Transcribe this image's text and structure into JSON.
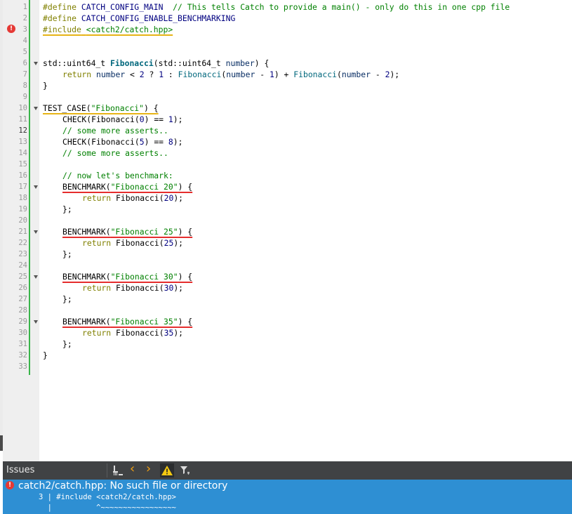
{
  "editor": {
    "line_numbers": [
      "1",
      "2",
      "3",
      "4",
      "5",
      "6",
      "7",
      "8",
      "9",
      "10",
      "11",
      "12",
      "13",
      "14",
      "15",
      "16",
      "17",
      "18",
      "19",
      "20",
      "21",
      "22",
      "23",
      "24",
      "25",
      "26",
      "27",
      "28",
      "29",
      "30",
      "31",
      "32",
      "33"
    ],
    "current_line": "12",
    "error_line": "3",
    "fold_lines": [
      "6",
      "10",
      "17",
      "21",
      "25",
      "29"
    ],
    "line1": {
      "directive": "#define",
      "macro": " CATCH_CONFIG_MAIN",
      "comment": "  // This tells Catch to provide a main() - only do this in one cpp file"
    },
    "line2": {
      "directive": "#define",
      "macro": " CATCH_CONFIG_ENABLE_BENCHMARKING"
    },
    "line3": {
      "directive": "#include",
      "path": "<catch2/catch.hpp>"
    },
    "line6": {
      "type_a": "std::uint64_t ",
      "fn": "Fibonacci",
      "open": "(",
      "type_b": "std::uint64_t ",
      "param": "number",
      "close": ") {"
    },
    "line7": {
      "kw": "return",
      "a": " ",
      "param1": "number",
      "b": " < ",
      "n2": "2",
      "c": " ? ",
      "n1": "1",
      "d": " : ",
      "fn1": "Fibonacci",
      "e": "(",
      "param2": "number",
      "f": " - ",
      "n3": "1",
      "g": ") + ",
      "fn2": "Fibonacci",
      "h": "(",
      "param3": "number",
      "i": " - ",
      "n4": "2",
      "j": ");"
    },
    "line8": "}",
    "line10": {
      "macro": "TEST_CASE(",
      "str": "\"Fibonacci\"",
      "rest": ") {"
    },
    "line11": {
      "macro": "CHECK(",
      "fn": "Fibonacci",
      "a": "(",
      "n0": "0",
      "b": ") == ",
      "n1": "1",
      "c": ");"
    },
    "line12": "// some more asserts..",
    "line13": {
      "macro": "CHECK(",
      "fn": "Fibonacci",
      "a": "(",
      "n0": "5",
      "b": ") == ",
      "n1": "8",
      "c": ");"
    },
    "line14": "// some more asserts..",
    "line16": "// now let's benchmark:",
    "benchmarks": [
      {
        "macro": "BENCHMARK(",
        "str": "\"Fibonacci 20\"",
        "rest": ") {",
        "ret": "return",
        "fn": "Fibonacci",
        "arg_open": "(",
        "arg": "20",
        "arg_close": ");",
        "close": "};"
      },
      {
        "macro": "BENCHMARK(",
        "str": "\"Fibonacci 25\"",
        "rest": ") {",
        "ret": "return",
        "fn": "Fibonacci",
        "arg_open": "(",
        "arg": "25",
        "arg_close": ");",
        "close": "};"
      },
      {
        "macro": "BENCHMARK(",
        "str": "\"Fibonacci 30\"",
        "rest": ") {",
        "ret": "return",
        "fn": "Fibonacci",
        "arg_open": "(",
        "arg": "30",
        "arg_close": ");",
        "close": "};"
      },
      {
        "macro": "BENCHMARK(",
        "str": "\"Fibonacci 35\"",
        "rest": ") {",
        "ret": "return",
        "fn": "Fibonacci",
        "arg_open": "(",
        "arg": "35",
        "arg_close": ");",
        "close": "};"
      }
    ],
    "line32": "}"
  },
  "issues": {
    "title": "Issues",
    "toolbar": {
      "clean_icon": "broom-icon",
      "prev_glyph": "‹",
      "next_glyph": "›",
      "warning_glyph": "!",
      "filter_glyph": "▼"
    },
    "message": "catch2/catch.hpp: No such file or directory",
    "detail_line1": "3 | #include <catch2/catch.hpp>",
    "detail_line2": "  |          ^~~~~~~~~~~~~~~~~~",
    "colors": {
      "accent": "#2e8fd3",
      "error": "#e53935",
      "warning_yellow": "#f2c811"
    }
  }
}
